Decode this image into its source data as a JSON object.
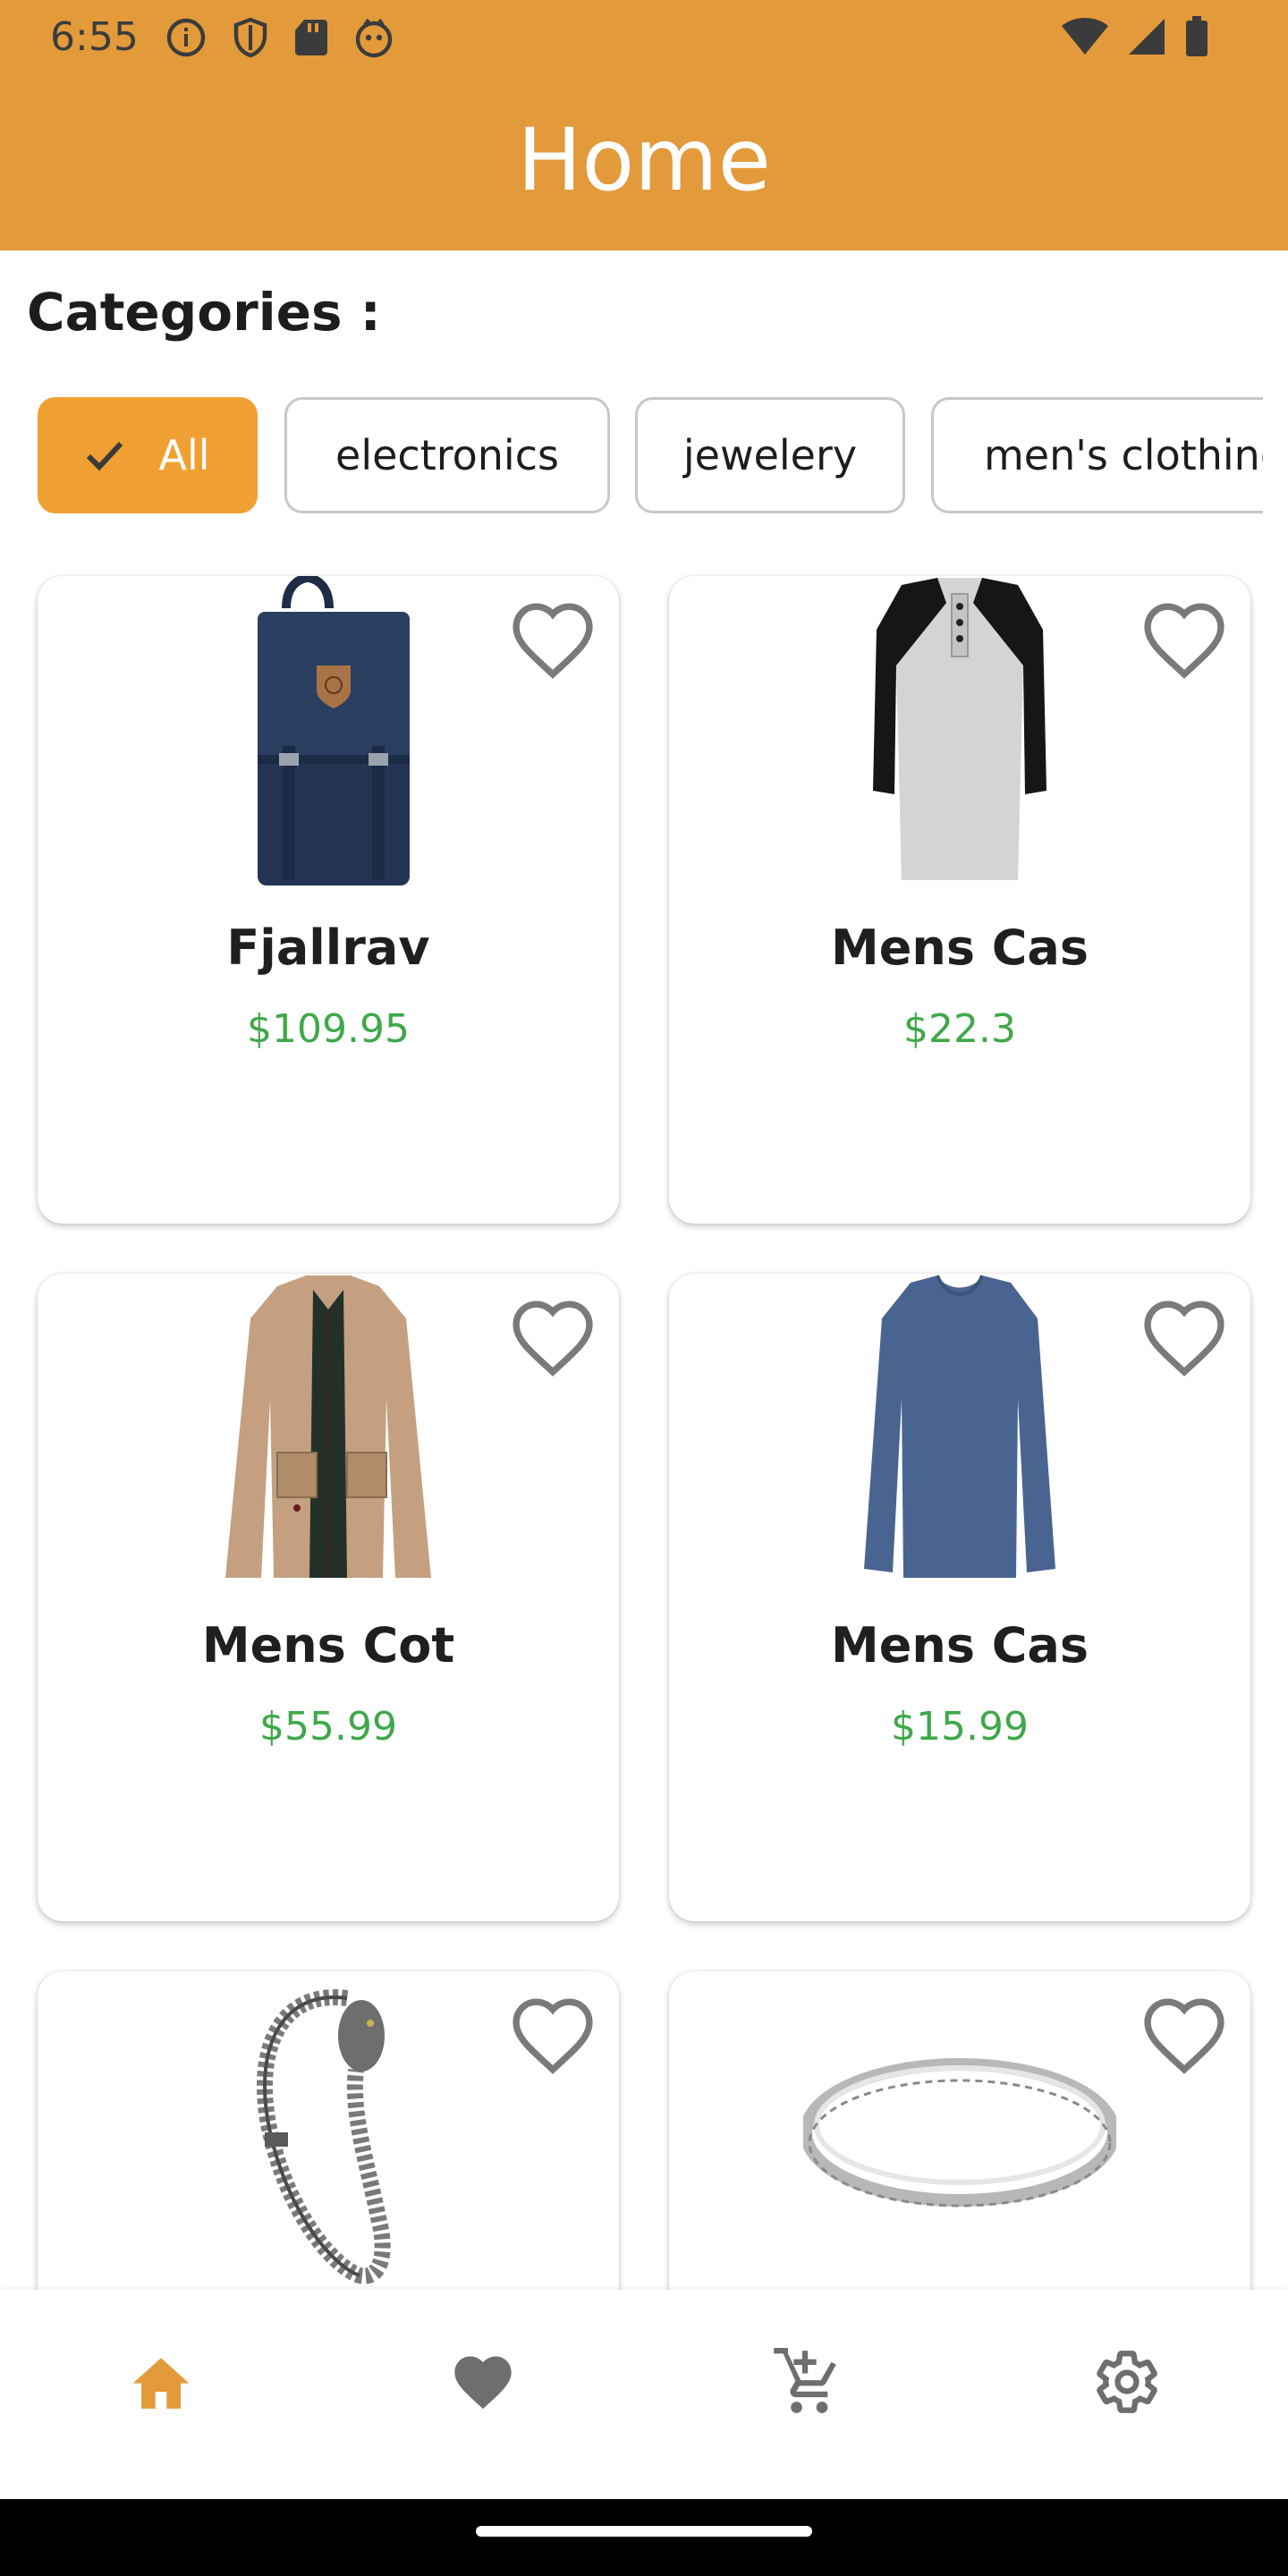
{
  "status_bar": {
    "time": "6:55",
    "left_icons": [
      "info-icon",
      "shield-icon",
      "sd-card-icon",
      "robot-face-icon"
    ],
    "right_icons": [
      "wifi-icon",
      "signal-icon",
      "battery-icon"
    ]
  },
  "header": {
    "title": "Home",
    "color": "#E39A3B"
  },
  "categories": {
    "title": "Categories :",
    "chips": [
      {
        "label": "All",
        "selected": true
      },
      {
        "label": "electronics",
        "selected": false
      },
      {
        "label": "jewelery",
        "selected": false
      },
      {
        "label": "men's clothing",
        "selected": false
      }
    ],
    "accent_color": "#F0A033"
  },
  "products": [
    {
      "name": "Fjallrav",
      "price": "$109.95",
      "image": "backpack-image"
    },
    {
      "name": "Mens Cas",
      "price": "$22.3",
      "image": "raglan-tshirt-image"
    },
    {
      "name": "Mens Cot",
      "price": "$55.99",
      "image": "cotton-jacket-image"
    },
    {
      "name": "Mens Cas",
      "price": "$15.99",
      "image": "long-sleeve-tshirt-image"
    },
    {
      "name": "",
      "price": "",
      "image": "dragon-bracelet-image"
    },
    {
      "name": "",
      "price": "",
      "image": "silver-ring-image"
    }
  ],
  "price_color": "#3fa84a",
  "bottom_nav": {
    "items": [
      {
        "icon": "home-icon",
        "active": true
      },
      {
        "icon": "heart-icon",
        "active": false
      },
      {
        "icon": "add-to-cart-icon",
        "active": false
      },
      {
        "icon": "settings-gear-icon",
        "active": false
      }
    ]
  }
}
